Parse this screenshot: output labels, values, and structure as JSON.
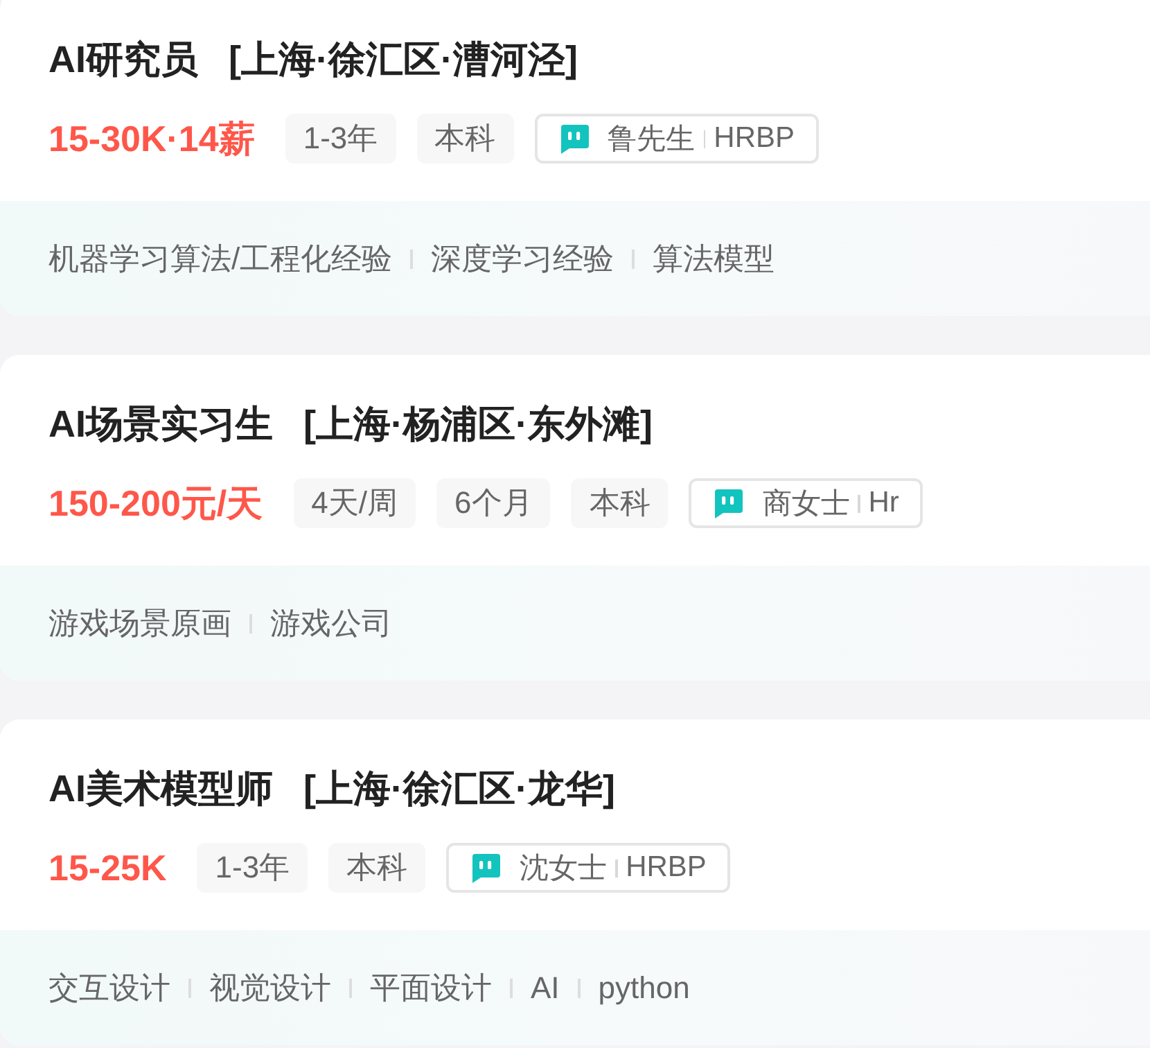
{
  "jobs": [
    {
      "title": "AI研究员",
      "location": "[上海·徐汇区·漕河泾]",
      "salary": "15-30K·14薪",
      "requirements": [
        "1-3年",
        "本科"
      ],
      "recruiter": {
        "name": "鲁先生",
        "role": "HRBP"
      },
      "skills": [
        "机器学习算法/工程化经验",
        "深度学习经验",
        "算法模型"
      ]
    },
    {
      "title": "AI场景实习生",
      "location": "[上海·杨浦区·东外滩]",
      "salary": "150-200元/天",
      "requirements": [
        "4天/周",
        "6个月",
        "本科"
      ],
      "recruiter": {
        "name": "商女士",
        "role": "Hr"
      },
      "skills": [
        "游戏场景原画",
        "游戏公司"
      ]
    },
    {
      "title": "AI美术模型师",
      "location": "[上海·徐汇区·龙华]",
      "salary": "15-25K",
      "requirements": [
        "1-3年",
        "本科"
      ],
      "recruiter": {
        "name": "沈女士",
        "role": "HRBP"
      },
      "skills": [
        "交互设计",
        "视觉设计",
        "平面设计",
        "AI",
        "python"
      ]
    }
  ]
}
